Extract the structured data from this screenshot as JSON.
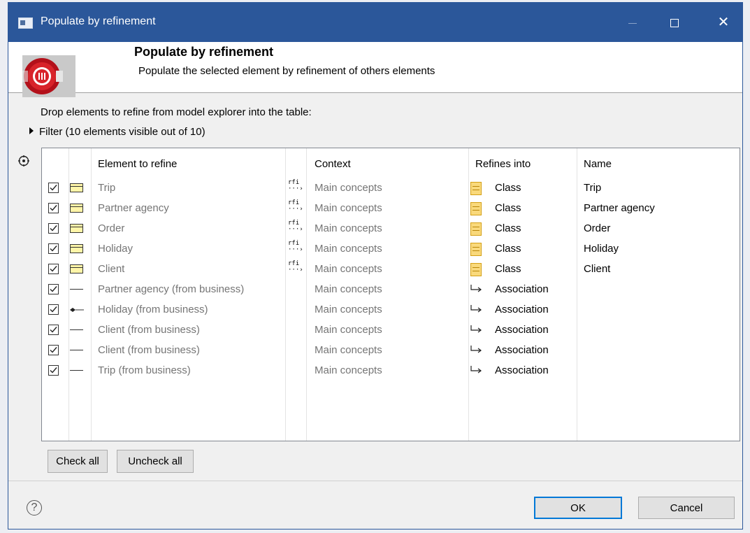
{
  "window": {
    "title": "Populate by refinement"
  },
  "banner": {
    "title": "Populate by refinement",
    "subtitle": "Populate the selected element by refinement of others elements"
  },
  "instruction": "Drop elements to refine from model explorer into the table:",
  "filter": {
    "label": "Filter (10 elements visible out of 10)"
  },
  "table": {
    "columns": {
      "element": "Element to refine",
      "context": "Context",
      "refines_into": "Refines into",
      "name": "Name"
    },
    "stereotype_label": "rfi",
    "rows": [
      {
        "checked": true,
        "icon": "class-icon",
        "element": "Trip",
        "context": "Main concepts",
        "refines_into": "Class",
        "refines_icon": "class-icon",
        "name": "Trip",
        "rfi": true
      },
      {
        "checked": true,
        "icon": "class-icon",
        "element": "Partner agency",
        "context": "Main concepts",
        "refines_into": "Class",
        "refines_icon": "class-icon",
        "name": "Partner agency",
        "rfi": true
      },
      {
        "checked": true,
        "icon": "class-icon",
        "element": "Order",
        "context": "Main concepts",
        "refines_into": "Class",
        "refines_icon": "class-icon",
        "name": "Order",
        "rfi": true
      },
      {
        "checked": true,
        "icon": "class-icon",
        "element": "Holiday",
        "context": "Main concepts",
        "refines_into": "Class",
        "refines_icon": "class-icon",
        "name": "Holiday",
        "rfi": true
      },
      {
        "checked": true,
        "icon": "class-icon",
        "element": "Client",
        "context": "Main concepts",
        "refines_into": "Class",
        "refines_icon": "class-icon",
        "name": "Client",
        "rfi": true
      },
      {
        "checked": true,
        "icon": "association-icon",
        "element": "Partner agency (from business)",
        "context": "Main concepts",
        "refines_into": "Association",
        "refines_icon": "association-arrow-icon",
        "name": "",
        "rfi": false
      },
      {
        "checked": true,
        "icon": "composition-icon",
        "element": "Holiday (from business)",
        "context": "Main concepts",
        "refines_into": "Association",
        "refines_icon": "association-arrow-icon",
        "name": "",
        "rfi": false
      },
      {
        "checked": true,
        "icon": "association-icon",
        "element": "Client (from business)",
        "context": "Main concepts",
        "refines_into": "Association",
        "refines_icon": "association-arrow-icon",
        "name": "",
        "rfi": false
      },
      {
        "checked": true,
        "icon": "association-icon",
        "element": "Client (from business)",
        "context": "Main concepts",
        "refines_into": "Association",
        "refines_icon": "association-arrow-icon",
        "name": "",
        "rfi": false
      },
      {
        "checked": true,
        "icon": "association-icon",
        "element": "Trip (from business)",
        "context": "Main concepts",
        "refines_into": "Association",
        "refines_icon": "association-arrow-icon",
        "name": "",
        "rfi": false
      }
    ]
  },
  "buttons": {
    "check_all": "Check all",
    "uncheck_all": "Uncheck all",
    "ok": "OK",
    "cancel": "Cancel",
    "help": "?"
  },
  "titlebar_buttons": {
    "close": "✕"
  },
  "colors": {
    "titlebar": "#2b579a",
    "class_icon": "#f9d97c",
    "gray_text": "#757575"
  }
}
